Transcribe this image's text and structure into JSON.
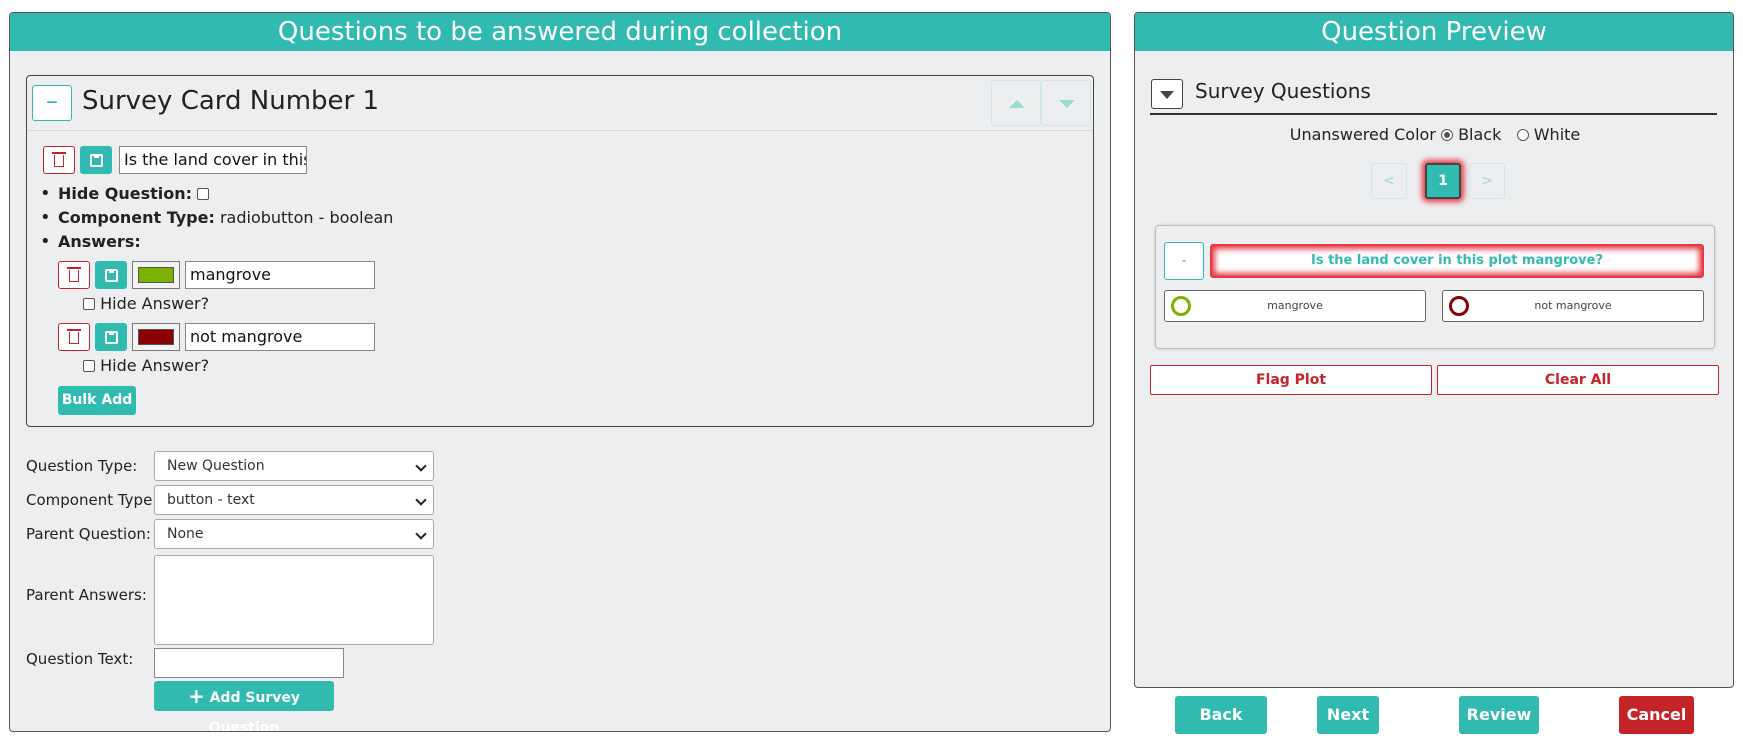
{
  "left_panel": {
    "header": "Questions to be answered during collection",
    "card": {
      "collapse_label": "–",
      "title": "Survey Card Number 1",
      "question_text_value": "Is the land cover in this pl",
      "hide_question_label": "Hide Question:",
      "component_type_label": "Component Type:",
      "component_type_value": "radiobutton - boolean",
      "answers_label": "Answers:",
      "answers": [
        {
          "text": "mangrove",
          "color": "#7cb100",
          "hide_label": "Hide Answer?"
        },
        {
          "text": "not mangrove",
          "color": "#8b0000",
          "hide_label": "Hide Answer?"
        }
      ],
      "bulk_add_label": "Bulk Add"
    },
    "form": {
      "question_type_label": "Question Type:",
      "question_type_value": "New Question",
      "component_type_label": "Component Type:",
      "component_type_value": "button - text",
      "parent_question_label": "Parent Question:",
      "parent_question_value": "None",
      "parent_answers_label": "Parent Answers:",
      "question_text_label": "Question Text:",
      "question_text_value": "",
      "add_button_label": "Add Survey Question"
    }
  },
  "right_panel": {
    "header": "Question Preview",
    "survey_questions_title": "Survey Questions",
    "unanswered_color_label": "Unanswered Color",
    "color_options": [
      "Black",
      "White"
    ],
    "selected_color": "Black",
    "pagination": {
      "prev": "<",
      "current": "1",
      "next": ">"
    },
    "question": {
      "collapse_label": "-",
      "text": "Is the land cover in this plot mangrove?",
      "answers": [
        {
          "text": "mangrove",
          "color": "#7cb100"
        },
        {
          "text": "not mangrove",
          "color": "#8b0000"
        }
      ]
    },
    "flag_plot_label": "Flag Plot",
    "clear_all_label": "Clear All"
  },
  "footer": {
    "back_label": "Back",
    "next_label": "Next",
    "review_label": "Review",
    "cancel_label": "Cancel"
  },
  "colors": {
    "teal": "#31bab0",
    "red": "#c42428",
    "panel_bg": "#eceeef"
  }
}
